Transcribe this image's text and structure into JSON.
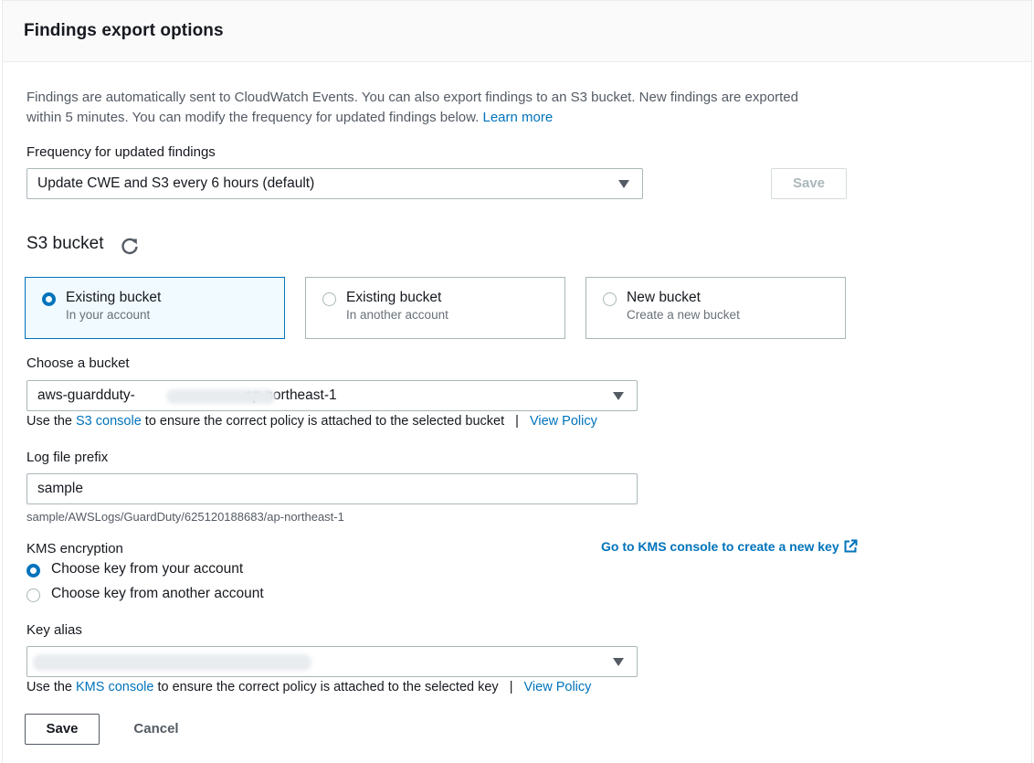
{
  "header": {
    "title": "Findings export options"
  },
  "description": {
    "text": "Findings are automatically sent to CloudWatch Events. You can also export findings to an S3 bucket. New findings are exported within 5 minutes. You can modify the frequency for updated findings below.",
    "learn_more": "Learn more"
  },
  "frequency": {
    "label": "Frequency for updated findings",
    "value": "Update CWE and S3 every 6 hours (default)",
    "save_label": "Save"
  },
  "s3": {
    "title": "S3 bucket",
    "refresh_icon": "refresh-icon",
    "tiles": [
      {
        "title": "Existing bucket",
        "subtitle": "In your account",
        "selected": true
      },
      {
        "title": "Existing bucket",
        "subtitle": "In another account",
        "selected": false
      },
      {
        "title": "New bucket",
        "subtitle": "Create a new bucket",
        "selected": false
      }
    ]
  },
  "bucket": {
    "label": "Choose a bucket",
    "value_prefix": "aws-guardduty-",
    "value_suffix": "ap-northeast-1",
    "hint_pre": "Use the",
    "hint_link": "S3 console",
    "hint_post": "to ensure the correct policy is attached to the selected bucket",
    "separator": "|",
    "view_policy": "View Policy"
  },
  "prefix": {
    "label": "Log file prefix",
    "value": "sample",
    "path": "sample/AWSLogs/GuardDuty/625120188683/ap-northeast-1"
  },
  "kms": {
    "label": "KMS encryption",
    "console_link": "Go to KMS console to create a new key",
    "options": [
      {
        "label": "Choose key from your account",
        "selected": true
      },
      {
        "label": "Choose key from another account",
        "selected": false
      }
    ]
  },
  "key_alias": {
    "label": "Key alias",
    "hint_pre": "Use the",
    "hint_link": "KMS console",
    "hint_post": "to ensure the correct policy is attached to the selected key",
    "separator": "|",
    "view_policy": "View Policy"
  },
  "footer": {
    "save_label": "Save",
    "cancel_label": "Cancel"
  },
  "colors": {
    "accent": "#0073bb",
    "border": "#aab7b8",
    "text": "#16191f",
    "muted": "#545b64"
  }
}
